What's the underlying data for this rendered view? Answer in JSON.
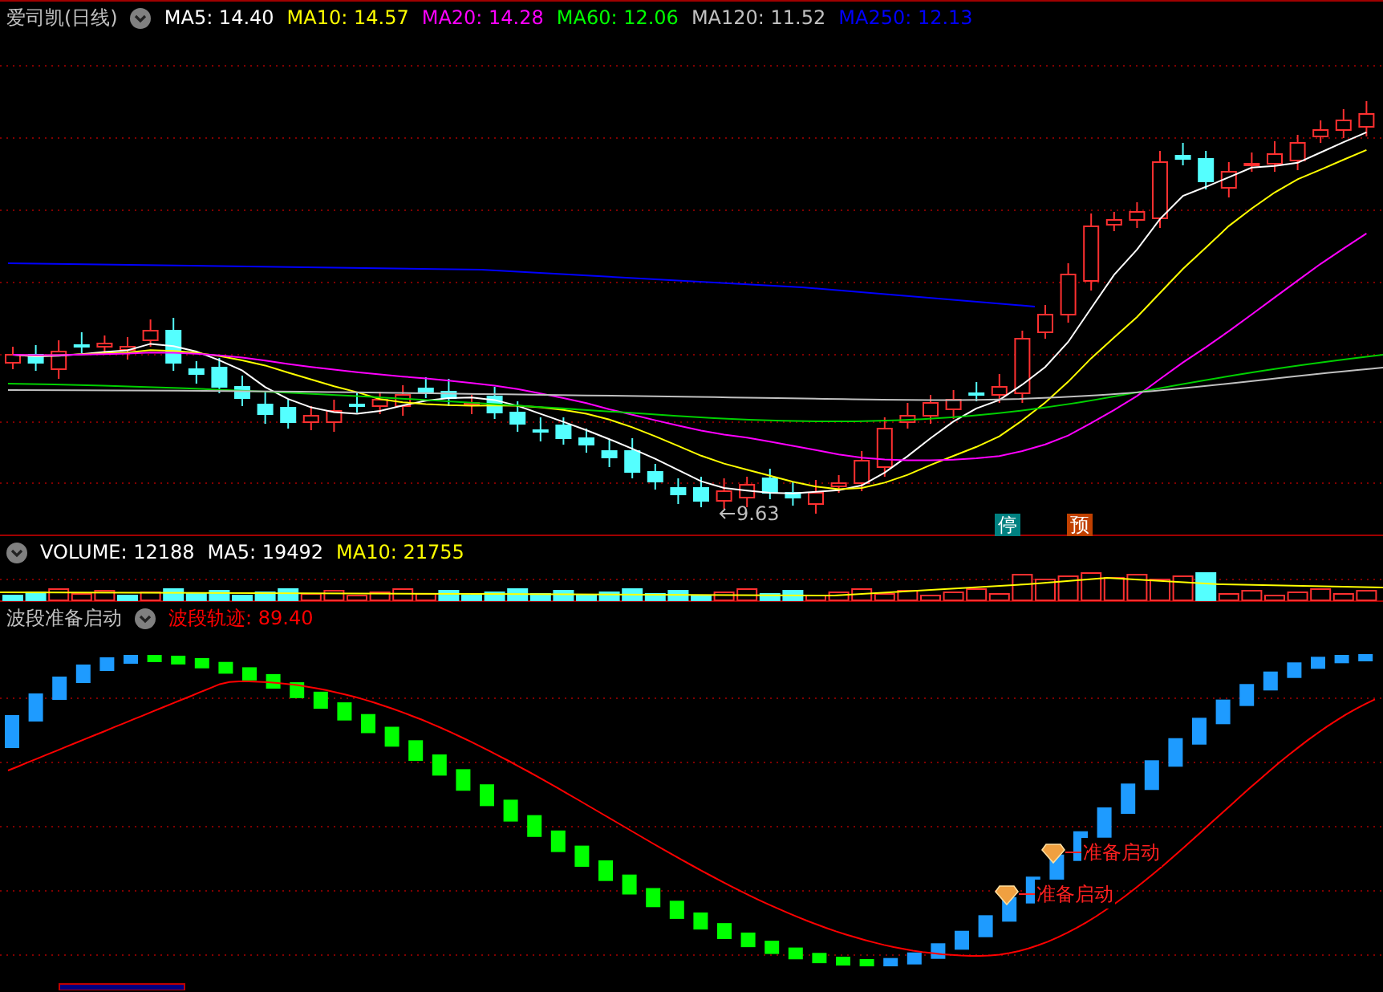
{
  "main_panel": {
    "title": "爱司凯(日线)",
    "indicators": [
      {
        "label": "MA5: 14.40",
        "color": "#ffffff"
      },
      {
        "label": "MA10: 14.57",
        "color": "#ffff00"
      },
      {
        "label": "MA20: 14.28",
        "color": "#ff00ff"
      },
      {
        "label": "MA60: 12.06",
        "color": "#00ff00"
      },
      {
        "label": "MA120: 11.52",
        "color": "#c0c0c0"
      },
      {
        "label": "MA250: 12.13",
        "color": "#0000ff"
      }
    ],
    "low_label": "9.63",
    "badges": [
      {
        "text": "停",
        "color": "#008080"
      },
      {
        "text": "预",
        "color": "#c04000"
      }
    ]
  },
  "volume_panel": {
    "indicators": [
      {
        "label": "VOLUME: 12188",
        "color": "#ffffff"
      },
      {
        "label": "MA5: 19492",
        "color": "#ffffff"
      },
      {
        "label": "MA10: 21755",
        "color": "#ffff00"
      }
    ]
  },
  "signal_panel": {
    "title": "波段准备启动",
    "indicators": [
      {
        "label": "波段轨迹: 89.40",
        "color": "#ff0000"
      }
    ],
    "signals": [
      {
        "text": "准备启动"
      },
      {
        "text": "准备启动"
      }
    ]
  }
}
